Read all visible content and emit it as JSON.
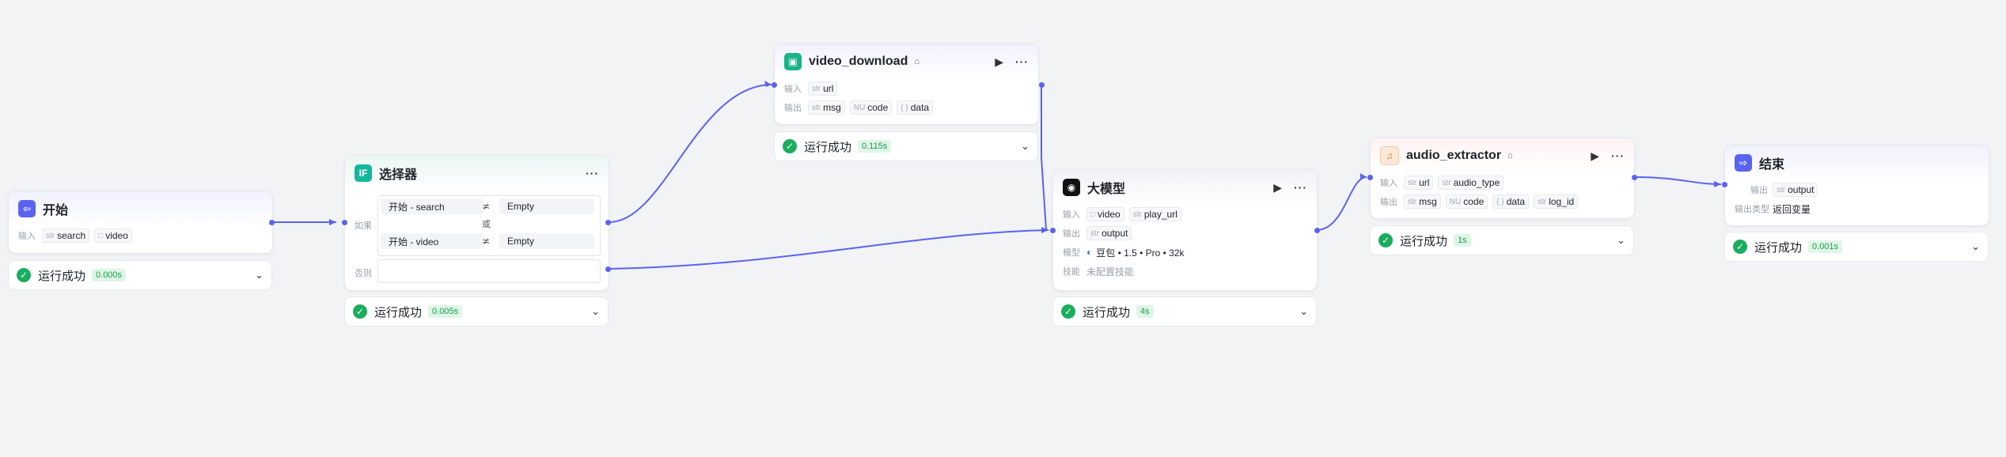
{
  "nodes": {
    "start": {
      "title": "开始",
      "input_label": "输入",
      "inputs": [
        {
          "type": "str",
          "name": "search"
        },
        {
          "type": "□",
          "name": "video"
        }
      ],
      "status": "运行成功",
      "duration": "0.000s"
    },
    "selector": {
      "title": "选择器",
      "if_label": "如果",
      "else_label": "否则",
      "or_label": "或",
      "conditions": [
        {
          "left": "开始  -  search",
          "op": "≭",
          "right": "Empty"
        },
        {
          "left": "开始  -  video",
          "op": "≭",
          "right": "Empty"
        }
      ],
      "status": "运行成功",
      "duration": "0.005s"
    },
    "video_download": {
      "title": "video_download",
      "input_label": "输入",
      "output_label": "输出",
      "inputs": [
        {
          "type": "str",
          "name": "url"
        }
      ],
      "outputs": [
        {
          "type": "str",
          "name": "msg"
        },
        {
          "type": "NU",
          "name": "code"
        },
        {
          "type": "{ }",
          "name": "data"
        }
      ],
      "status": "运行成功",
      "duration": "0.115s"
    },
    "llm": {
      "title": "大模型",
      "input_label": "输入",
      "output_label": "输出",
      "model_label": "模型",
      "skill_label": "技能",
      "inputs": [
        {
          "type": "□",
          "name": "video"
        },
        {
          "type": "str",
          "name": "play_url"
        }
      ],
      "outputs": [
        {
          "type": "str",
          "name": "output"
        }
      ],
      "model": "豆包 • 1.5 • Pro • 32k",
      "skill": "未配置技能",
      "status": "运行成功",
      "duration": "4s"
    },
    "audio_extractor": {
      "title": "audio_extractor",
      "input_label": "输入",
      "output_label": "输出",
      "inputs": [
        {
          "type": "str",
          "name": "url"
        },
        {
          "type": "str",
          "name": "audio_type"
        }
      ],
      "outputs": [
        {
          "type": "str",
          "name": "msg"
        },
        {
          "type": "NU",
          "name": "code"
        },
        {
          "type": "{ }",
          "name": "data"
        },
        {
          "type": "str",
          "name": "log_id"
        }
      ],
      "status": "运行成功",
      "duration": "1s"
    },
    "end": {
      "title": "结束",
      "output_label": "输出",
      "output_type_label": "输出类型",
      "outputs": [
        {
          "type": "str",
          "name": "output"
        }
      ],
      "output_type": "返回变量",
      "status": "运行成功",
      "duration": "0.001s"
    }
  },
  "colors": {
    "accent": "#5a63f0",
    "success": "#1aad5e",
    "success_bg": "#dff6e6"
  }
}
